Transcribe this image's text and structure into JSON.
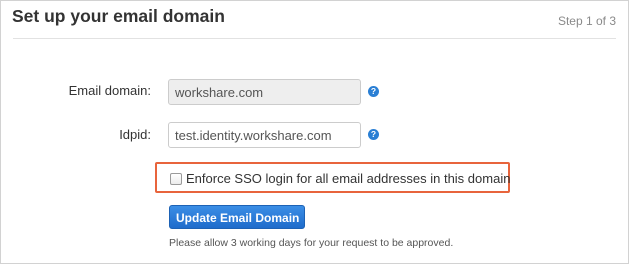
{
  "header": {
    "title": "Set up your email domain",
    "step": "Step 1 of 3"
  },
  "form": {
    "email_domain": {
      "label": "Email domain:",
      "value": "workshare.com",
      "help_icon": "question-circle-icon"
    },
    "idpid": {
      "label": "Idpid:",
      "value": "test.identity.workshare.com",
      "help_icon": "question-circle-icon"
    },
    "enforce_sso": {
      "label": "Enforce SSO login for all email addresses in this domain",
      "checked": false,
      "highlight_color": "#e8643c"
    },
    "submit_label": "Update Email Domain",
    "note": "Please allow 3 working days for your request to be approved."
  },
  "colors": {
    "primary_button": "#2a7fd4",
    "help_icon": "#2a7fd4",
    "highlight_border": "#e8643c"
  }
}
